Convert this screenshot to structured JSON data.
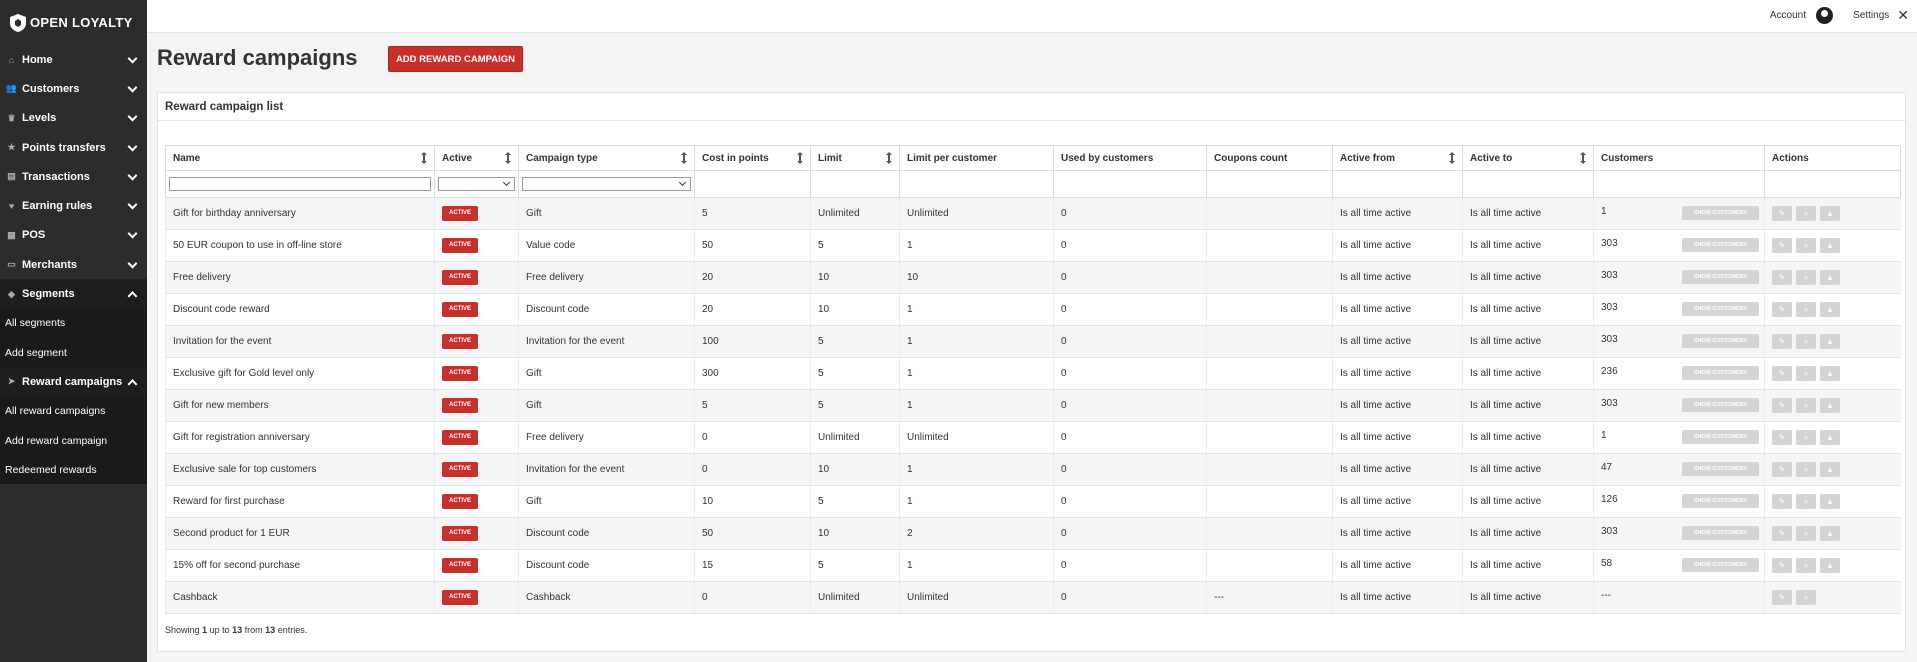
{
  "app": {
    "logo_text": "OPEN LOYALTY"
  },
  "sidebar": {
    "items": [
      {
        "label": "Home",
        "icon": "home-icon",
        "glyph": "⌂",
        "open": false
      },
      {
        "label": "Customers",
        "icon": "users-icon",
        "glyph": "👥",
        "open": false
      },
      {
        "label": "Levels",
        "icon": "trophy-icon",
        "glyph": "♛",
        "open": false
      },
      {
        "label": "Points transfers",
        "icon": "star-icon",
        "glyph": "★",
        "open": false
      },
      {
        "label": "Transactions",
        "icon": "document-icon",
        "glyph": "▤",
        "open": false
      },
      {
        "label": "Earning rules",
        "icon": "heart-icon",
        "glyph": "♥",
        "open": false
      },
      {
        "label": "POS",
        "icon": "pos-icon",
        "glyph": "▦",
        "open": false
      },
      {
        "label": "Merchants",
        "icon": "merchant-icon",
        "glyph": "▭",
        "open": false
      },
      {
        "label": "Segments",
        "icon": "tag-icon",
        "glyph": "◆",
        "open": true
      },
      {
        "label": "Reward campaigns",
        "icon": "paper-plane-icon",
        "glyph": "➤",
        "open": true
      }
    ],
    "segments_sub": [
      "All segments",
      "Add segment"
    ],
    "rewards_sub": [
      "All reward campaigns",
      "Add reward campaign",
      "Redeemed rewards"
    ]
  },
  "topbar": {
    "account_label": "Account",
    "settings_label": "Settings"
  },
  "page": {
    "title": "Reward campaigns",
    "add_button": "ADD REWARD CAMPAIGN"
  },
  "panel": {
    "title": "Reward campaign list",
    "columns": [
      "Name",
      "Active",
      "Campaign type",
      "Cost in points",
      "Limit",
      "Limit per customer",
      "Used by customers",
      "Coupons count",
      "Active from",
      "Active to",
      "Customers",
      "Actions"
    ],
    "show_customers_label": "SHOW CUSTOMERS",
    "rows": [
      {
        "name": "Gift for birthday anniversary",
        "active": "ACTIVE",
        "type": "Gift",
        "cost": "5",
        "limit": "Unlimited",
        "limit_per_customer": "Unlimited",
        "used": "0",
        "coupons": "",
        "from": "Is all time active",
        "to": "Is all time active",
        "customers": "1",
        "show_btn": true,
        "actions": 3
      },
      {
        "name": "50 EUR coupon to use in off-line store",
        "active": "ACTIVE",
        "type": "Value code",
        "cost": "50",
        "limit": "5",
        "limit_per_customer": "1",
        "used": "0",
        "coupons": "",
        "from": "Is all time active",
        "to": "Is all time active",
        "customers": "303",
        "show_btn": true,
        "actions": 3
      },
      {
        "name": "Free delivery",
        "active": "ACTIVE",
        "type": "Free delivery",
        "cost": "20",
        "limit": "10",
        "limit_per_customer": "10",
        "used": "0",
        "coupons": "",
        "from": "Is all time active",
        "to": "Is all time active",
        "customers": "303",
        "show_btn": true,
        "actions": 3
      },
      {
        "name": "Discount code reward",
        "active": "ACTIVE",
        "type": "Discount code",
        "cost": "20",
        "limit": "10",
        "limit_per_customer": "1",
        "used": "0",
        "coupons": "",
        "from": "Is all time active",
        "to": "Is all time active",
        "customers": "303",
        "show_btn": true,
        "actions": 3
      },
      {
        "name": "Invitation for the event",
        "active": "ACTIVE",
        "type": "Invitation for the event",
        "cost": "100",
        "limit": "5",
        "limit_per_customer": "1",
        "used": "0",
        "coupons": "",
        "from": "Is all time active",
        "to": "Is all time active",
        "customers": "303",
        "show_btn": true,
        "actions": 3
      },
      {
        "name": "Exclusive gift for Gold level only",
        "active": "ACTIVE",
        "type": "Gift",
        "cost": "300",
        "limit": "5",
        "limit_per_customer": "1",
        "used": "0",
        "coupons": "",
        "from": "Is all time active",
        "to": "Is all time active",
        "customers": "236",
        "show_btn": true,
        "actions": 3
      },
      {
        "name": "Gift for new members",
        "active": "ACTIVE",
        "type": "Gift",
        "cost": "5",
        "limit": "5",
        "limit_per_customer": "1",
        "used": "0",
        "coupons": "",
        "from": "Is all time active",
        "to": "Is all time active",
        "customers": "303",
        "show_btn": true,
        "actions": 3
      },
      {
        "name": "Gift for registration anniversary",
        "active": "ACTIVE",
        "type": "Free delivery",
        "cost": "0",
        "limit": "Unlimited",
        "limit_per_customer": "Unlimited",
        "used": "0",
        "coupons": "",
        "from": "Is all time active",
        "to": "Is all time active",
        "customers": "1",
        "show_btn": true,
        "actions": 3
      },
      {
        "name": "Exclusive sale for top customers",
        "active": "ACTIVE",
        "type": "Invitation for the event",
        "cost": "0",
        "limit": "10",
        "limit_per_customer": "1",
        "used": "0",
        "coupons": "",
        "from": "Is all time active",
        "to": "Is all time active",
        "customers": "47",
        "show_btn": true,
        "actions": 3
      },
      {
        "name": "Reward for first purchase",
        "active": "ACTIVE",
        "type": "Gift",
        "cost": "10",
        "limit": "5",
        "limit_per_customer": "1",
        "used": "0",
        "coupons": "",
        "from": "Is all time active",
        "to": "Is all time active",
        "customers": "126",
        "show_btn": true,
        "actions": 3
      },
      {
        "name": "Second product for 1 EUR",
        "active": "ACTIVE",
        "type": "Discount code",
        "cost": "50",
        "limit": "10",
        "limit_per_customer": "2",
        "used": "0",
        "coupons": "",
        "from": "Is all time active",
        "to": "Is all time active",
        "customers": "303",
        "show_btn": true,
        "actions": 3
      },
      {
        "name": "15% off for second purchase",
        "active": "ACTIVE",
        "type": "Discount code",
        "cost": "15",
        "limit": "5",
        "limit_per_customer": "1",
        "used": "0",
        "coupons": "",
        "from": "Is all time active",
        "to": "Is all time active",
        "customers": "58",
        "show_btn": true,
        "actions": 3
      },
      {
        "name": "Cashback",
        "active": "ACTIVE",
        "type": "Cashback",
        "cost": "0",
        "limit": "Unlimited",
        "limit_per_customer": "Unlimited",
        "used": "0",
        "coupons": "---",
        "from": "Is all time active",
        "to": "Is all time active",
        "customers": "---",
        "show_btn": false,
        "actions": 2
      }
    ],
    "footer": {
      "prefix": "Showing",
      "start": "1",
      "mid1": "up to",
      "end": "13",
      "mid2": "from",
      "total": "13",
      "suffix": "entries."
    }
  },
  "colors": {
    "accent": "#c9302c",
    "sidebar_bg": "#2c2c2c",
    "disabled_btn": "#d4d4d4"
  }
}
